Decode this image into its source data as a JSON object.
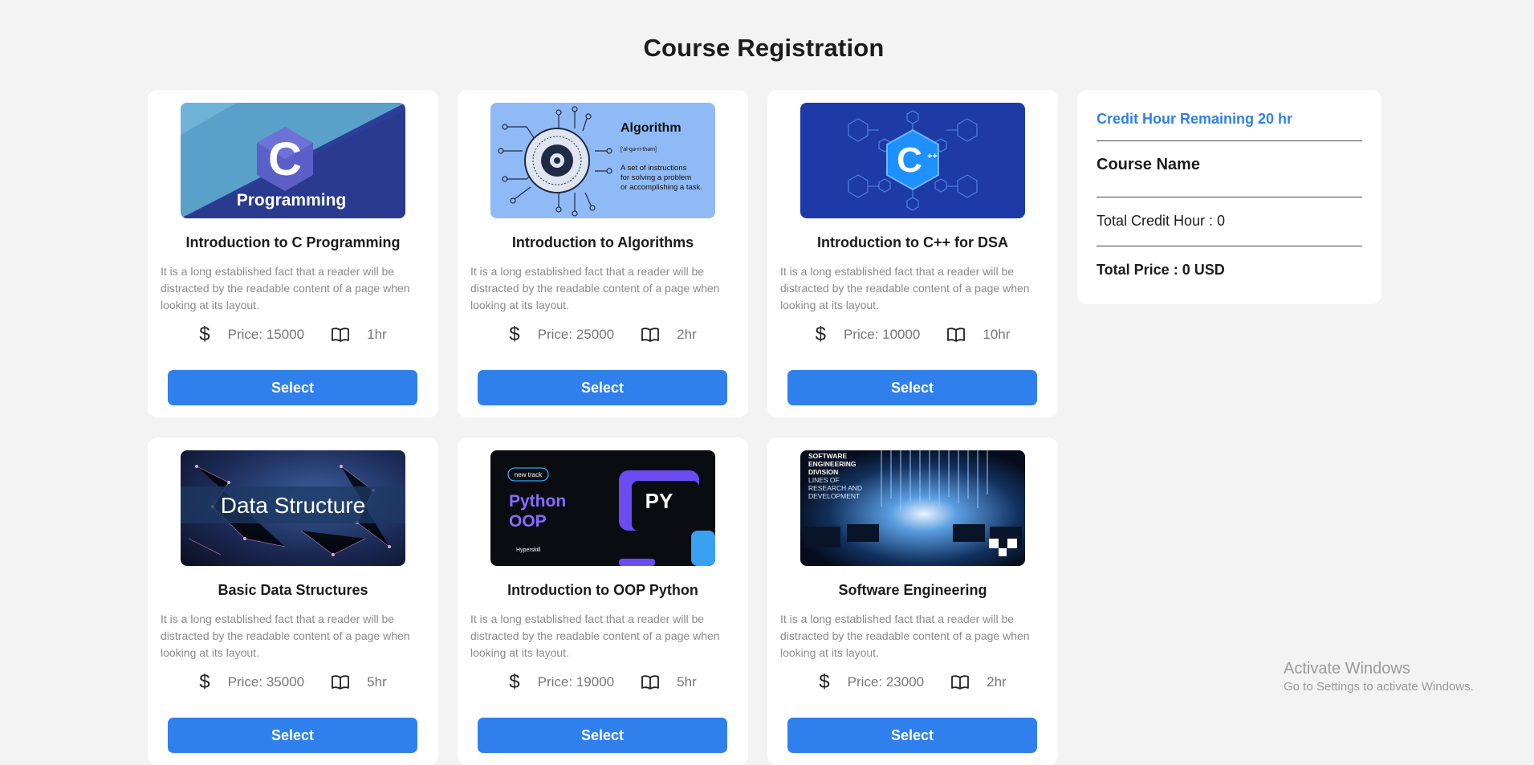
{
  "page": {
    "title": "Course Registration"
  },
  "courses": [
    {
      "title": "Introduction to C Programming",
      "description": "It is a long established fact that a reader will be distracted by the readable content of a page when looking at its layout.",
      "price_label": "Price: 15000",
      "duration": "1hr",
      "select_label": "Select",
      "image": "c-programming",
      "image_text": "Programming",
      "image_letter": "C"
    },
    {
      "title": "Introduction to Algorithms",
      "description": "It is a long established fact that a reader will be distracted by the readable content of a page when looking at its layout.",
      "price_label": "Price: 25000",
      "duration": "2hr",
      "select_label": "Select",
      "image": "algorithm",
      "image_text": "Algorithm",
      "image_phonetic": "['al-gə-ri-thəm]",
      "image_def1": "A set of instructions",
      "image_def2": "for solving a problem",
      "image_def3": "or accomplishing a task."
    },
    {
      "title": "Introduction to C++ for DSA",
      "description": "It is a long established fact that a reader will be distracted by the readable content of a page when looking at its layout.",
      "price_label": "Price: 10000",
      "duration": "10hr",
      "select_label": "Select",
      "image": "cpp",
      "image_letter": "C",
      "image_sup": "++"
    },
    {
      "title": "Basic Data Structures",
      "description": "It is a long established fact that a reader will be distracted by the readable content of a page when looking at its layout.",
      "price_label": "Price: 35000",
      "duration": "5hr",
      "select_label": "Select",
      "image": "data-structure",
      "image_text": "Data Structure"
    },
    {
      "title": "Introduction to OOP Python",
      "description": "It is a long established fact that a reader will be distracted by the readable content of a page when looking at its layout.",
      "price_label": "Price: 19000",
      "duration": "5hr",
      "select_label": "Select",
      "image": "python-oop",
      "image_badge": "new track",
      "image_text1": "Python",
      "image_text2": "OOP",
      "image_py": "PY",
      "image_brand": "Hyperskill"
    },
    {
      "title": "Software Engineering",
      "description": "It is a long established fact that a reader will be distracted by the readable content of a page when looking at its layout.",
      "price_label": "Price: 23000",
      "duration": "2hr",
      "select_label": "Select",
      "image": "software-engineering",
      "image_l1": "SOFTWARE",
      "image_l2": "ENGINEERING",
      "image_l3": "DIVISION",
      "image_l4": "LINES OF",
      "image_l5": "RESEARCH AND",
      "image_l6": "DEVELOPMENT"
    }
  ],
  "sidebar": {
    "remaining": "Credit Hour Remaining 20 hr",
    "course_name_heading": "Course Name",
    "total_credit": "Total Credit Hour : 0",
    "total_price": "Total Price : 0 USD"
  },
  "watermark": {
    "title": "Activate Windows",
    "subtitle": "Go to Settings to activate Windows."
  },
  "icons": {
    "price": "dollar-icon",
    "duration": "book-icon"
  },
  "colors": {
    "accent": "#2f80ed",
    "background": "#f3f3f3",
    "card": "#ffffff"
  }
}
